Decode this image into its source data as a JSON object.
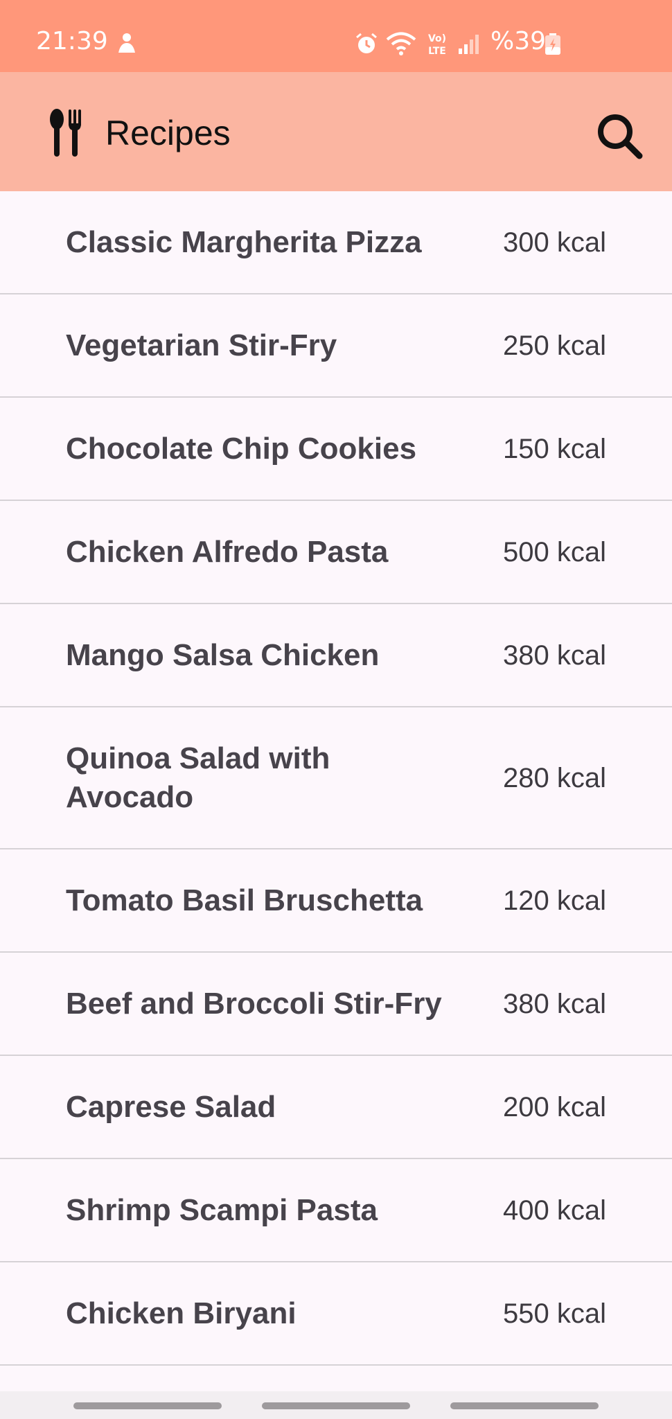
{
  "status_bar": {
    "time": "21:39",
    "battery_percent": "%39",
    "icons": [
      "app-notification-icon",
      "alarm-icon",
      "wifi-icon",
      "volte-lte-icon",
      "signal-icon",
      "battery-charging-icon"
    ]
  },
  "app_bar": {
    "title": "Recipes",
    "logo_icon": "fork-spoon-icon",
    "search_icon": "search-icon"
  },
  "colors": {
    "status_bar": "#ff977a",
    "app_bar": "#fbb5a1",
    "background": "#fdf7fc",
    "text": "#47434b",
    "divider": "#d6d2d6"
  },
  "recipes": [
    {
      "name": "Classic Margherita Pizza",
      "calories": "300 kcal"
    },
    {
      "name": "Vegetarian Stir-Fry",
      "calories": "250 kcal"
    },
    {
      "name": "Chocolate Chip Cookies",
      "calories": "150 kcal"
    },
    {
      "name": "Chicken Alfredo Pasta",
      "calories": "500 kcal"
    },
    {
      "name": "Mango Salsa Chicken",
      "calories": "380 kcal"
    },
    {
      "name": "Quinoa Salad with Avocado",
      "calories": "280 kcal"
    },
    {
      "name": "Tomato Basil Bruschetta",
      "calories": "120 kcal"
    },
    {
      "name": "Beef and Broccoli Stir-Fry",
      "calories": "380 kcal"
    },
    {
      "name": "Caprese Salad",
      "calories": "200 kcal"
    },
    {
      "name": "Shrimp Scampi Pasta",
      "calories": "400 kcal"
    },
    {
      "name": "Chicken Biryani",
      "calories": "550 kcal"
    }
  ]
}
